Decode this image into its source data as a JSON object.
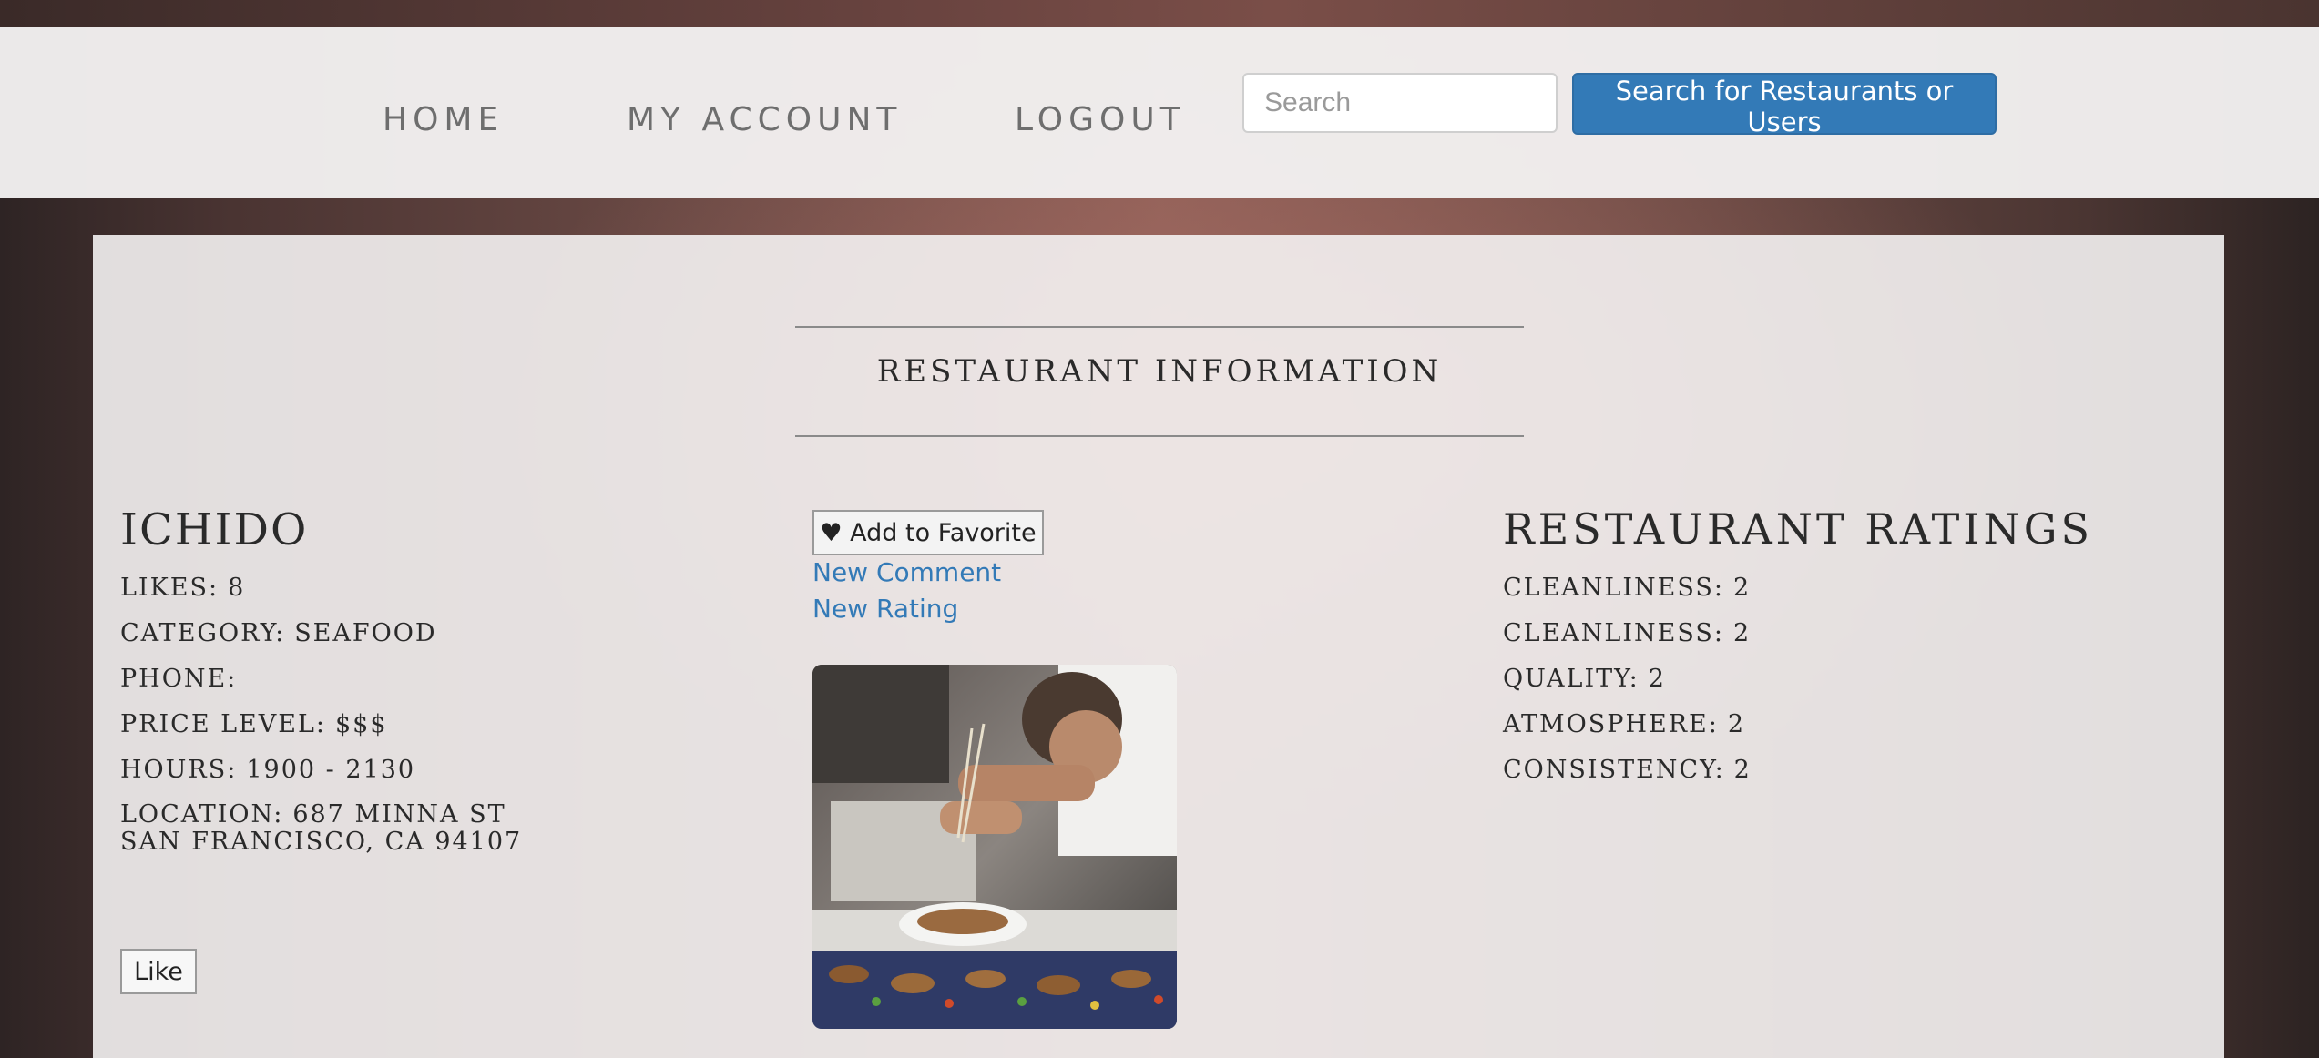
{
  "nav": {
    "home": "HOME",
    "my_account": "MY ACCOUNT",
    "logout": "LOGOUT",
    "search_placeholder": "Search",
    "search_button": "Search for Restaurants or Users"
  },
  "section_title": "RESTAURANT INFORMATION",
  "restaurant": {
    "name": "ICHIDO",
    "likes_label": "LIKES:",
    "likes": "8",
    "category_label": "CATEGORY:",
    "category": "SEAFOOD",
    "phone_label": "PHONE:",
    "phone": "",
    "price_label": "PRICE LEVEL:",
    "price": "$$$",
    "hours_label": "HOURS:",
    "hours": "1900 - 2130",
    "location_label": "LOCATION:",
    "address_line1": "687 MINNA ST",
    "address_line2": "SAN FRANCISCO, CA 94107"
  },
  "actions": {
    "like_button": "Like",
    "favorite_icon": "heart-icon",
    "favorite_glyph": "♥",
    "favorite_button": "Add to Favorite",
    "new_comment": "New Comment",
    "new_rating": "New Rating"
  },
  "ratings": {
    "title": "RESTAURANT RATINGS",
    "items": [
      {
        "label": "CLEANLINESS:",
        "value": "2"
      },
      {
        "label": "CLEANLINESS:",
        "value": "2"
      },
      {
        "label": "QUALITY:",
        "value": "2"
      },
      {
        "label": "ATMOSPHERE:",
        "value": "2"
      },
      {
        "label": "CONSISTENCY:",
        "value": "2"
      }
    ]
  },
  "colors": {
    "accent": "#337ab7",
    "navbar_bg": "#f2f0f0",
    "panel_bg": "#f4f2f2",
    "nav_text": "#6e6e6e"
  }
}
